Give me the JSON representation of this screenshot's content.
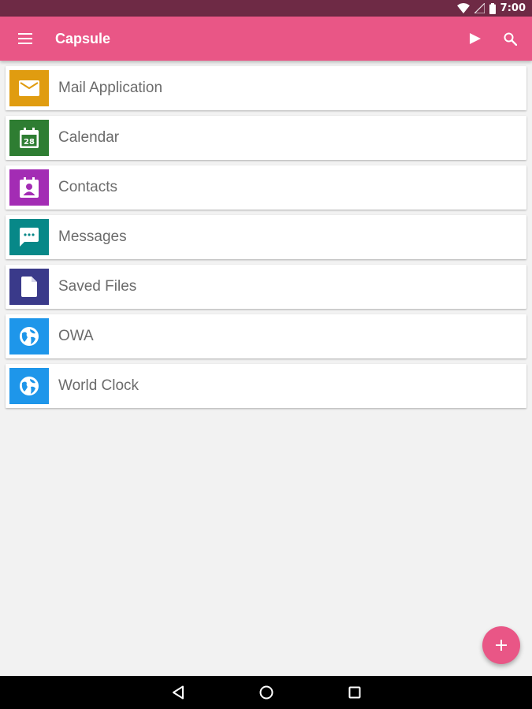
{
  "status_bar": {
    "time": "7:00"
  },
  "app_bar": {
    "title": "Capsule"
  },
  "colors": {
    "status_bar": "#6e2a45",
    "app_bar": "#e95686",
    "fab": "#e95686"
  },
  "items": [
    {
      "label": "Mail Application",
      "icon": "mail-icon",
      "color": "#e09c10"
    },
    {
      "label": "Calendar",
      "icon": "calendar-icon",
      "calendar_day": "28",
      "color": "#2e7d32"
    },
    {
      "label": "Contacts",
      "icon": "contact-icon",
      "color": "#a32cb4"
    },
    {
      "label": "Messages",
      "icon": "message-icon",
      "color": "#078888"
    },
    {
      "label": "Saved Files",
      "icon": "file-icon",
      "color": "#3a3a8a"
    },
    {
      "label": "OWA",
      "icon": "globe-icon",
      "color": "#1e96ea"
    },
    {
      "label": "World Clock",
      "icon": "globe-icon",
      "color": "#1e96ea"
    }
  ]
}
